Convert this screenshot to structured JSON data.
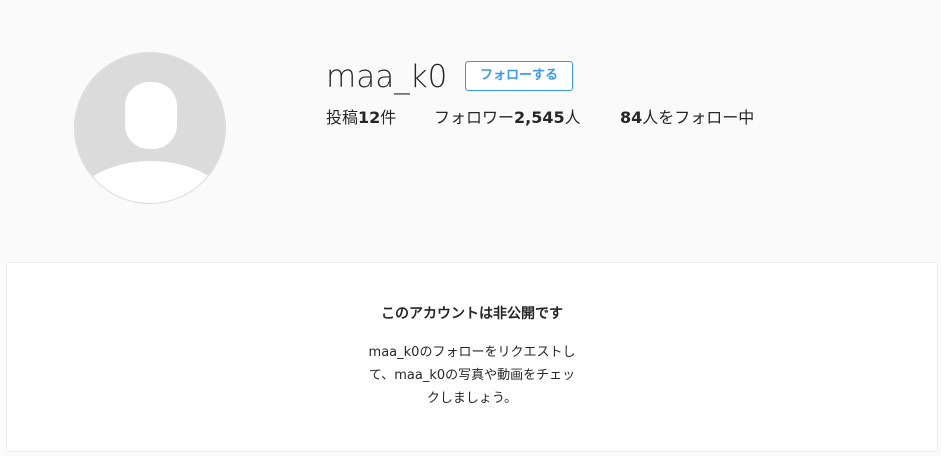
{
  "profile": {
    "username": "maa_k0",
    "follow_button_label": "フォローする",
    "avatar_icon": "default-avatar-icon"
  },
  "stats": {
    "posts_prefix": "投稿",
    "posts_count": "12",
    "posts_suffix": "件",
    "followers_prefix": "フォロワー",
    "followers_count": "2,545",
    "followers_suffix": "人",
    "following_count": "84",
    "following_suffix": "人をフォロー中"
  },
  "private_notice": {
    "title": "このアカウントは非公開です",
    "description_line1": "maa_k0のフォローをリクエストし",
    "description_line2": "て、maa_k0の写真や動画をチェッ",
    "description_line3": "クしましょう。"
  },
  "colors": {
    "background": "#fafafa",
    "accent": "#3897f0",
    "text": "#262626",
    "avatar_bg": "#dbdbdb"
  }
}
